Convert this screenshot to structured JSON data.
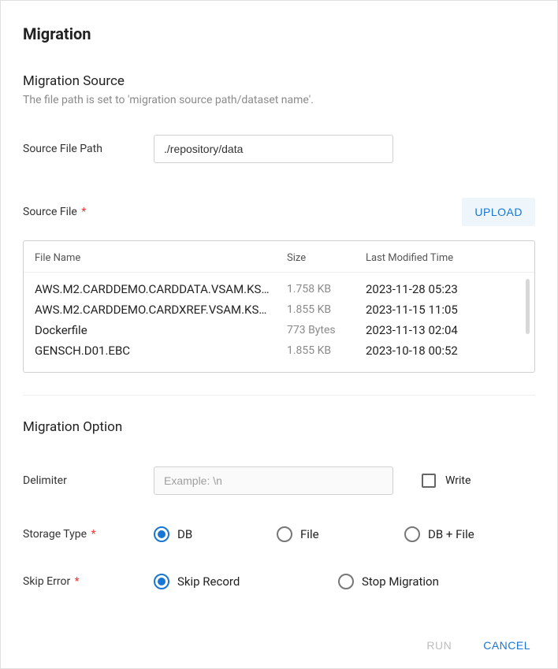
{
  "dialog": {
    "title": "Migration"
  },
  "source": {
    "section_title": "Migration Source",
    "section_subtext": "The file path is set to 'migration source path/dataset name'.",
    "path_label": "Source File Path",
    "path_value": "./repository/data",
    "file_label": "Source File",
    "upload_label": "UPLOAD"
  },
  "table": {
    "headers": {
      "name": "File Name",
      "size": "Size",
      "time": "Last Modified Time"
    },
    "rows": [
      {
        "name": "AWS.M2.CARDDEMO.CARDDATA.VSAM.KS…",
        "size": "1.758 KB",
        "time": "2023-11-28 05:23"
      },
      {
        "name": "AWS.M2.CARDDEMO.CARDXREF.VSAM.KS…",
        "size": "1.855 KB",
        "time": "2023-11-15 11:05"
      },
      {
        "name": "Dockerfile",
        "size": "773 Bytes",
        "time": "2023-11-13 02:04"
      },
      {
        "name": "GENSCH.D01.EBC",
        "size": "1.855 KB",
        "time": "2023-10-18 00:52"
      }
    ]
  },
  "option": {
    "section_title": "Migration Option",
    "delimiter_label": "Delimiter",
    "delimiter_placeholder": "Example: \\n",
    "write_label": "Write",
    "storage_type_label": "Storage Type",
    "storage_options": {
      "db": "DB",
      "file": "File",
      "dbfile": "DB + File"
    },
    "skip_error_label": "Skip Error",
    "skip_options": {
      "skip": "Skip Record",
      "stop": "Stop Migration"
    }
  },
  "footer": {
    "run": "RUN",
    "cancel": "CANCEL"
  }
}
